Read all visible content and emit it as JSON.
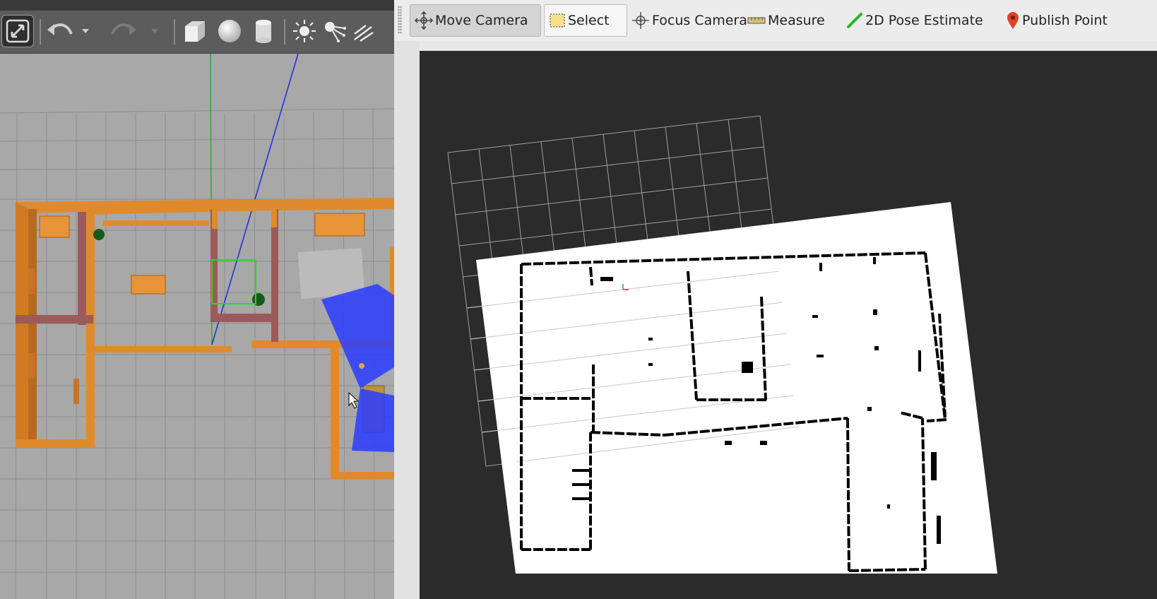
{
  "gazebo": {
    "toolbar": {
      "buttons": [
        {
          "name": "fullscreen-icon"
        },
        {
          "name": "undo-icon"
        },
        {
          "name": "undo-history-dropdown-icon"
        },
        {
          "name": "redo-icon"
        },
        {
          "name": "redo-history-dropdown-icon"
        },
        {
          "name": "box-icon"
        },
        {
          "name": "sphere-icon"
        },
        {
          "name": "cylinder-icon"
        },
        {
          "name": "point-light-icon"
        },
        {
          "name": "spot-light-icon"
        },
        {
          "name": "directional-light-icon"
        }
      ]
    },
    "colors": {
      "wall": "#e08a2e",
      "wall_dark": "#9c5a5a",
      "floor": "#a8a8a8",
      "grid": "#8e8e8e",
      "laser": "#2a3cff"
    }
  },
  "rviz": {
    "toolbar": {
      "tools": [
        {
          "id": "move_camera",
          "label": "Move Camera",
          "icon": "move-camera-icon",
          "state": "pressed"
        },
        {
          "id": "select",
          "label": "Select",
          "icon": "select-icon",
          "state": "bordered"
        },
        {
          "id": "focus_camera",
          "label": "Focus Camera",
          "icon": "focus-camera-icon",
          "state": "normal"
        },
        {
          "id": "measure",
          "label": "Measure",
          "icon": "measure-icon",
          "state": "normal"
        },
        {
          "id": "pose_estimate",
          "label": "2D Pose Estimate",
          "icon": "pose-estimate-icon",
          "state": "normal"
        },
        {
          "id": "publish_point",
          "label": "Publish Point",
          "icon": "publish-point-icon",
          "state": "normal"
        }
      ]
    },
    "colors": {
      "background": "#2b2b2b",
      "map_free": "#ffffff",
      "map_occupied": "#000000",
      "grid": "#a0a0a0"
    }
  }
}
